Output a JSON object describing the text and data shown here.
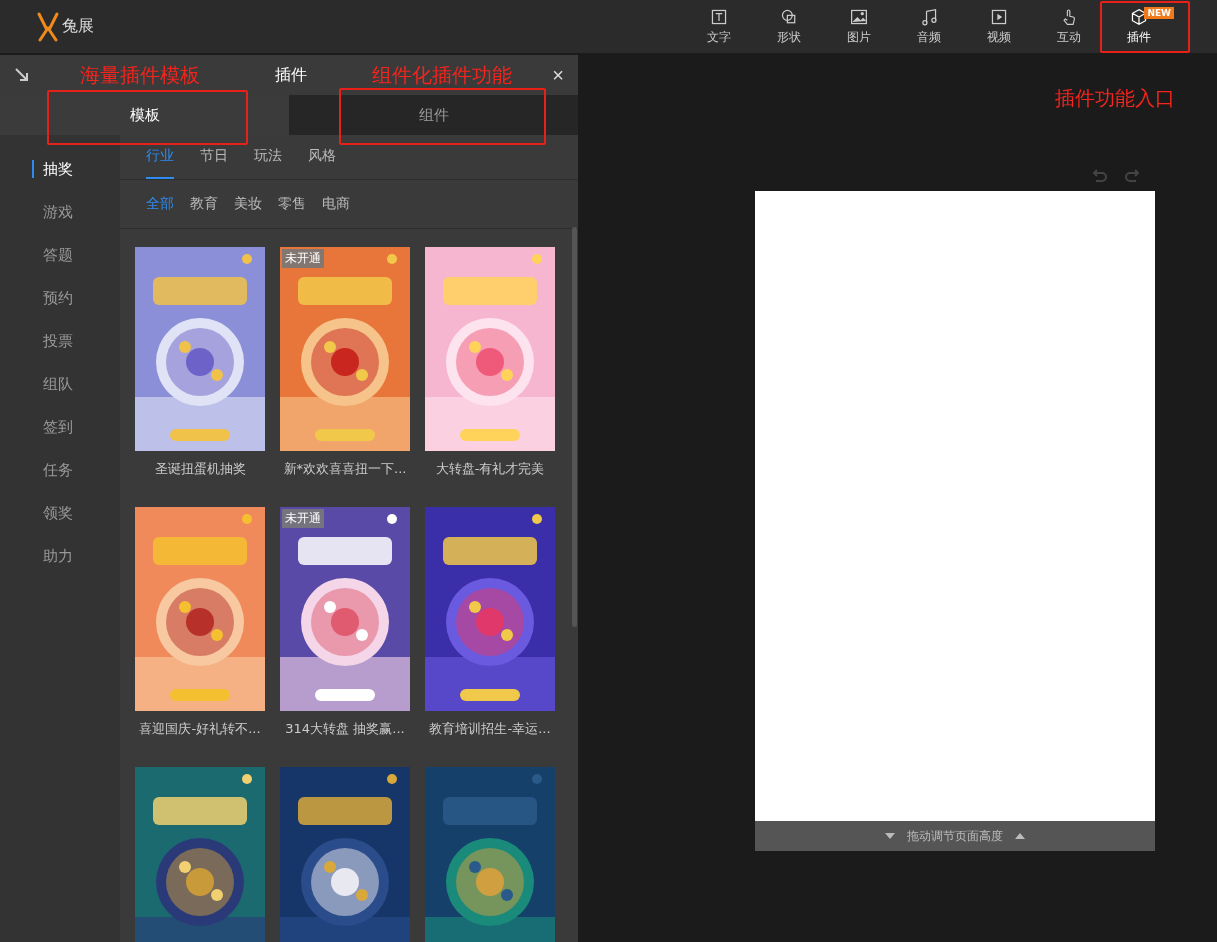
{
  "app": {
    "logo_text": "兔展"
  },
  "toolbar": [
    {
      "label": "文字",
      "selected": false
    },
    {
      "label": "形状",
      "selected": false
    },
    {
      "label": "图片",
      "selected": false
    },
    {
      "label": "音频",
      "selected": false
    },
    {
      "label": "视频",
      "selected": false
    },
    {
      "label": "互动",
      "selected": false
    },
    {
      "label": "插件",
      "selected": true,
      "badge": "NEW"
    }
  ],
  "panel": {
    "title": "插件",
    "close": "×",
    "tabs": [
      {
        "label": "模板",
        "selected": true
      },
      {
        "label": "组件",
        "selected": false
      }
    ],
    "sidebar": [
      {
        "label": "抽奖",
        "selected": true
      },
      {
        "label": "游戏",
        "selected": false
      },
      {
        "label": "答题",
        "selected": false
      },
      {
        "label": "预约",
        "selected": false
      },
      {
        "label": "投票",
        "selected": false
      },
      {
        "label": "组队",
        "selected": false
      },
      {
        "label": "签到",
        "selected": false
      },
      {
        "label": "任务",
        "selected": false
      },
      {
        "label": "领奖",
        "selected": false
      },
      {
        "label": "助力",
        "selected": false
      }
    ],
    "categories": [
      {
        "label": "行业",
        "selected": true
      },
      {
        "label": "节日",
        "selected": false
      },
      {
        "label": "玩法",
        "selected": false
      },
      {
        "label": "风格",
        "selected": false
      }
    ],
    "filters": [
      {
        "label": "全部",
        "selected": true
      },
      {
        "label": "教育",
        "selected": false
      },
      {
        "label": "美妆",
        "selected": false
      },
      {
        "label": "零售",
        "selected": false
      },
      {
        "label": "电商",
        "selected": false
      }
    ],
    "templates": [
      {
        "kind": "picture",
        "title": "圣诞扭蛋机抽奖"
      },
      {
        "kind": "picture",
        "title": "新*欢欢喜喜扭一下...",
        "badge": "未开通"
      },
      {
        "kind": "picture",
        "title": "大转盘-有礼才完美"
      },
      {
        "kind": "picture",
        "title": "喜迎国庆-好礼转不..."
      },
      {
        "kind": "picture",
        "title": "314大转盘 抽奖赢...",
        "badge": "未开通"
      },
      {
        "kind": "picture",
        "title": "教育培训招生-幸运..."
      },
      {
        "kind": "picture"
      },
      {
        "kind": "picture"
      },
      {
        "kind": "picture"
      }
    ]
  },
  "canvas": {
    "resize_hint": "拖动调节页面高度"
  },
  "annotations": [
    {
      "text": "海量插件模板"
    },
    {
      "text": "组件化插件功能"
    },
    {
      "text": "插件功能入口"
    }
  ]
}
